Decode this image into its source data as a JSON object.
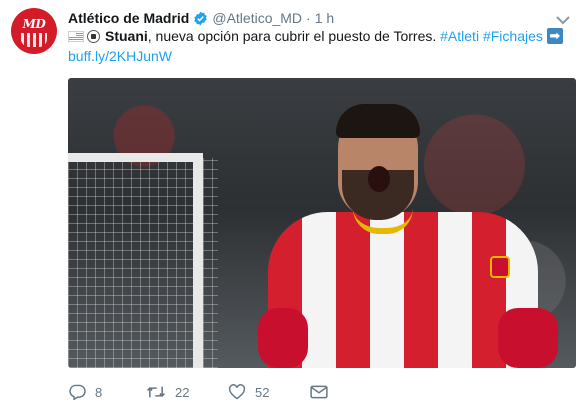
{
  "tweet": {
    "display_name": "Atlético de Madrid",
    "handle": "@Atletico_MD",
    "separator": "·",
    "time": "1 h",
    "avatar_text": "MD",
    "body": {
      "player_name": "Stuani",
      "text": ", nueva opción para cubrir el puesto de Torres. ",
      "hashtag_1": "#Atleti",
      "hashtag_2": "#Fichajes",
      "link": "buff.ly/2KHJunW"
    },
    "icons": {
      "verified": "verified-badge-icon",
      "flag": "uruguay-flag-icon",
      "ball": "soccer-ball-icon",
      "arrow": "right-arrow-icon",
      "more": "chevron-down-icon"
    },
    "actions": {
      "reply_count": "8",
      "retweet_count": "22",
      "like_count": "52"
    }
  },
  "colors": {
    "link": "#1da1f2",
    "muted": "#657786",
    "text": "#14171a",
    "brand_red": "#d31b29"
  }
}
